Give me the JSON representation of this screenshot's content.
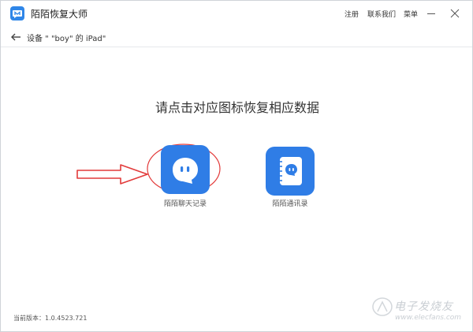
{
  "window": {
    "title": "陌陌恢复大师",
    "menu": {
      "register": "注册",
      "contact": "联系我们",
      "menu": "菜单"
    }
  },
  "nav": {
    "device_label": "设备 \" \"boy\" 的 iPad\""
  },
  "main": {
    "prompt": "请点击对应图标恢复相应数据",
    "items": [
      {
        "label": "陌陌聊天记录",
        "icon": "chat-bubble-icon"
      },
      {
        "label": "陌陌通讯录",
        "icon": "contacts-book-icon"
      }
    ]
  },
  "footer": {
    "version": "当前版本：1.0.4523.721"
  },
  "watermark": {
    "text": "电子发烧友",
    "url": "www.elecfans.com"
  },
  "colors": {
    "accent": "#2f7de6",
    "annotation": "#e23a3a"
  }
}
